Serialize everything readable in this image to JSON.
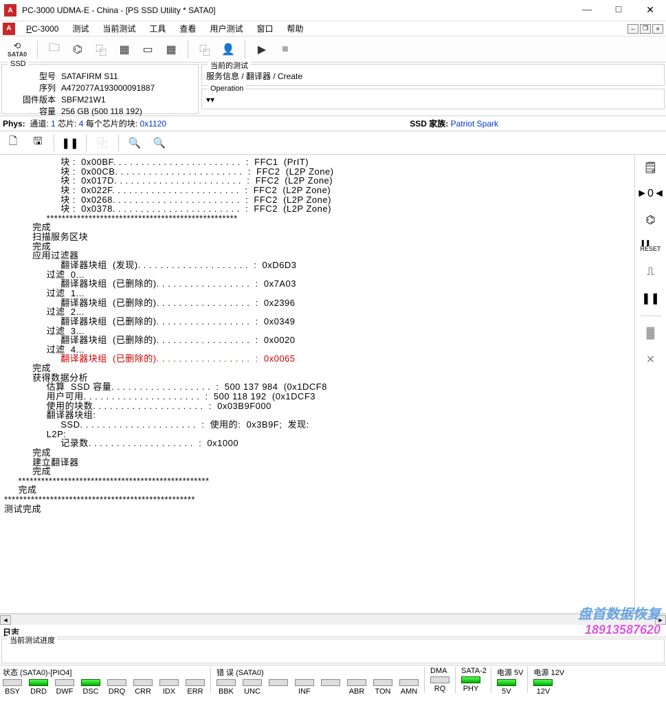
{
  "titlebar": {
    "app_icon_text": "A",
    "title": "PC-3000 UDMA-E - China - [PS SSD Utility * SATA0]"
  },
  "menu": {
    "app_icon": "A",
    "items": [
      "PC-3000",
      "测试",
      "当前测试",
      "工具",
      "查看",
      "用户测试",
      "窗口",
      "帮助"
    ]
  },
  "toolbar_icons": [
    "SATA0",
    "folder",
    "chip",
    "pages",
    "stack",
    "ruler",
    "grid",
    "copy",
    "exit",
    "play",
    "stop"
  ],
  "ssd_panel": {
    "legend": "SSD",
    "rows": [
      {
        "label": "型号",
        "value": "SATAFIRM   S11"
      },
      {
        "label": "序列",
        "value": "A472077A193000091887"
      },
      {
        "label": "固件版本",
        "value": "SBFM21W1"
      },
      {
        "label": "容量",
        "value": "256 GB (500 118 192)"
      }
    ]
  },
  "current_test_panel": {
    "legend": "当前的测试",
    "breadcrumb": "服务信息 / 翻译器 / Create"
  },
  "operation_panel": {
    "legend": "Operation",
    "value": "▾"
  },
  "phys_row": {
    "phys_label": "Phys:",
    "channel_label": "通道:",
    "channel_value": "1",
    "chip_label": "芯片:",
    "chip_value": "4",
    "per_chip_label": "每个芯片的块:",
    "per_chip_value": "0x1120",
    "ssd_label": "SSD 家族:",
    "ssd_value": "Patriot Spark"
  },
  "log_lines": [
    {
      "t": "                    块 :  0x00BF. . . . . . . . . . . . . . . . . . . . . . .  :  FFC1  (PrIT)",
      "c": ""
    },
    {
      "t": "                    块 :  0x00CB. . . . . . . . . . . . . . . . . . . . . . .  :  FFC2  (L2P Zone)",
      "c": ""
    },
    {
      "t": "                    块 :  0x017D. . . . . . . . . . . . . . . . . . . . . . .  :  FFC2  (L2P Zone)",
      "c": ""
    },
    {
      "t": "                    块 :  0x022F. . . . . . . . . . . . . . . . . . . . . . .  :  FFC2  (L2P Zone)",
      "c": ""
    },
    {
      "t": "                    块 :  0x0268. . . . . . . . . . . . . . . . . . . . . . .  :  FFC2  (L2P Zone)",
      "c": ""
    },
    {
      "t": "                    块 :  0x0378. . . . . . . . . . . . . . . . . . . . . . .  :  FFC2  (L2P Zone)",
      "c": ""
    },
    {
      "t": "               **************************************************",
      "c": ""
    },
    {
      "t": "          完成",
      "c": ""
    },
    {
      "t": "",
      "c": ""
    },
    {
      "t": "          扫描服务区块",
      "c": ""
    },
    {
      "t": "          完成",
      "c": ""
    },
    {
      "t": "",
      "c": ""
    },
    {
      "t": "          应用过滤器",
      "c": ""
    },
    {
      "t": "                    翻译器块组  (发现). . . . . . . . . . . . . . . . . . . .  :  0xD6D3",
      "c": ""
    },
    {
      "t": "",
      "c": ""
    },
    {
      "t": "               过滤  0...",
      "c": ""
    },
    {
      "t": "                    翻译器块组  (已删除的). . . . . . . . . . . . . . . . .  :  0x7A03",
      "c": ""
    },
    {
      "t": "",
      "c": ""
    },
    {
      "t": "               过滤  1...",
      "c": ""
    },
    {
      "t": "                    翻译器块组  (已删除的). . . . . . . . . . . . . . . . .  :  0x2396",
      "c": ""
    },
    {
      "t": "",
      "c": ""
    },
    {
      "t": "               过滤  2...",
      "c": ""
    },
    {
      "t": "                    翻译器块组  (已删除的). . . . . . . . . . . . . . . . .  :  0x0349",
      "c": ""
    },
    {
      "t": "",
      "c": ""
    },
    {
      "t": "               过滤  3...",
      "c": ""
    },
    {
      "t": "                    翻译器块组  (已删除的). . . . . . . . . . . . . . . . .  :  0x0020",
      "c": ""
    },
    {
      "t": "",
      "c": ""
    },
    {
      "t": "               过滤  4...",
      "c": ""
    },
    {
      "t": "                    翻译器块组  (已删除的). . . . . . . . . . . . . . . . .  :  0x0065",
      "c": "red"
    },
    {
      "t": "          完成",
      "c": ""
    },
    {
      "t": "",
      "c": ""
    },
    {
      "t": "          获得数据分析",
      "c": ""
    },
    {
      "t": "               估算  SSD 容量. . . . . . . . . . . . . . . . . .  :  500 137 984  (0x1DCF8",
      "c": ""
    },
    {
      "t": "               用户可用. . . . . . . . . . . . . . . . . . . . .  :  500 118 192  (0x1DCF3",
      "c": ""
    },
    {
      "t": "               使用的块数. . . . . . . . . . . . . . . . . . . .  :  0x03B9F000",
      "c": ""
    },
    {
      "t": "",
      "c": ""
    },
    {
      "t": "               翻译器块组:",
      "c": ""
    },
    {
      "t": "                    SSD. . . . . . . . . . . . . . . . . . . . .  :  使用的:  0x3B9F;  发现:",
      "c": ""
    },
    {
      "t": "",
      "c": ""
    },
    {
      "t": "               L2P:",
      "c": ""
    },
    {
      "t": "                    记录数. . . . . . . . . . . . . . . . . . .  :  0x1000",
      "c": ""
    },
    {
      "t": "          完成",
      "c": ""
    },
    {
      "t": "",
      "c": ""
    },
    {
      "t": "          建立翻译器",
      "c": ""
    },
    {
      "t": "          完成",
      "c": ""
    },
    {
      "t": "     **************************************************",
      "c": ""
    },
    {
      "t": "     完成",
      "c": ""
    },
    {
      "t": "**************************************************",
      "c": ""
    },
    {
      "t": "测试完成",
      "c": ""
    }
  ],
  "right_icons": [
    "info",
    "plug",
    "chip2",
    "reset",
    "usb",
    "pause",
    "chip3",
    "wrench"
  ],
  "log_label": "日志",
  "progress_legend": "当前测试进度",
  "status": {
    "group1": {
      "label": "状态 (SATA0)-[PIO4]",
      "leds": [
        {
          "name": "BSY",
          "on": false
        },
        {
          "name": "DRD",
          "on": true
        },
        {
          "name": "DWF",
          "on": false
        },
        {
          "name": "DSC",
          "on": true
        },
        {
          "name": "DRQ",
          "on": false
        },
        {
          "name": "CRR",
          "on": false
        },
        {
          "name": "IDX",
          "on": false
        },
        {
          "name": "ERR",
          "on": false
        }
      ]
    },
    "group2": {
      "label": "错 误 (SATA0)",
      "leds": [
        {
          "name": "BBK",
          "on": false
        },
        {
          "name": "UNC",
          "on": false
        },
        {
          "name": "",
          "on": false
        },
        {
          "name": "INF",
          "on": false
        },
        {
          "name": "",
          "on": false
        },
        {
          "name": "ABR",
          "on": false
        },
        {
          "name": "TON",
          "on": false
        },
        {
          "name": "AMN",
          "on": false
        }
      ]
    },
    "group3": {
      "label": "DMA",
      "leds": [
        {
          "name": "RQ",
          "on": false
        }
      ]
    },
    "group4": {
      "label": "SATA-2",
      "leds": [
        {
          "name": "PHY",
          "on": true
        }
      ]
    },
    "group5": {
      "label": "电源 5V",
      "leds": [
        {
          "name": "5V",
          "on": true
        }
      ]
    },
    "group6": {
      "label": "电源 12V",
      "leds": [
        {
          "name": "12V",
          "on": true
        }
      ]
    }
  },
  "watermark": {
    "line1": "盘首数据恢复",
    "line2": "18913587620"
  }
}
